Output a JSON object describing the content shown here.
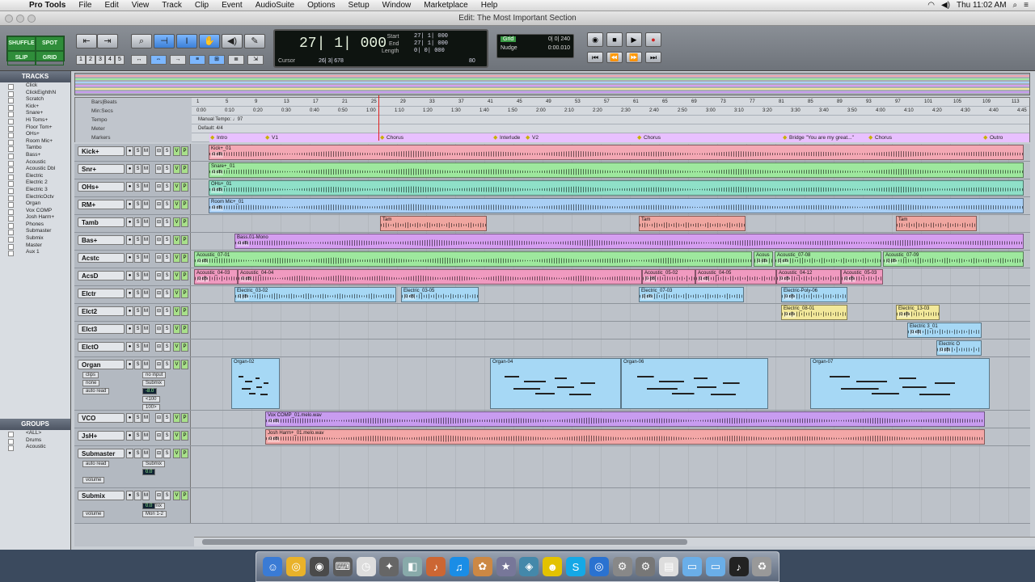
{
  "menubar": {
    "app": "Pro Tools",
    "items": [
      "File",
      "Edit",
      "View",
      "Track",
      "Clip",
      "Event",
      "AudioSuite",
      "Options",
      "Setup",
      "Window",
      "Marketplace",
      "Help"
    ],
    "clock": "Thu 11:02 AM"
  },
  "window": {
    "title": "Edit: The Most Important Section"
  },
  "toolbar": {
    "modes": [
      "SHUFFLE",
      "SPOT",
      "SLIP",
      "GRID"
    ],
    "zoom_presets": [
      "1",
      "2",
      "3",
      "4",
      "5"
    ],
    "counter": {
      "main": "27| 1| 000",
      "labels": [
        "Start",
        "End",
        "Length"
      ],
      "values": [
        "27| 1| 000",
        "27| 1| 000",
        "0| 0| 000"
      ],
      "cursor_label": "Cursor",
      "cursor_value": "26| 3| 678",
      "tempo": "80"
    },
    "grid": {
      "label": "Grid",
      "value": "0| 0| 240",
      "nudge_label": "Nudge",
      "nudge_value": "0:00.010"
    }
  },
  "tracklist": {
    "header": "TRACKS",
    "items": [
      "Click",
      "ClickEighthN",
      "Scratch",
      "Kick+",
      "Snare+",
      "Hi Toms+",
      "Floor Tom+",
      "OHs+",
      "Room Mic+",
      "Tambo",
      "Bass+",
      "Acoustic",
      "Acoustic Dbl",
      "Electric",
      "Electric 2",
      "Electric 3",
      "ElectricOctv",
      "Organ",
      "Vox COMP",
      "Josh Harm+",
      "Phones",
      "Submaster",
      "Submix",
      "Master",
      "Aux 1"
    ]
  },
  "groups": {
    "header": "GROUPS",
    "items": [
      "<ALL>",
      "Drums",
      "Acoustic"
    ]
  },
  "rulers": {
    "rows": [
      "Bars|Beats",
      "Min:Secs",
      "Tempo",
      "Meter",
      "Markers"
    ],
    "bars": [
      "1",
      "5",
      "9",
      "13",
      "17",
      "21",
      "25",
      "29",
      "33",
      "37",
      "41",
      "45",
      "49",
      "53",
      "57",
      "61",
      "65",
      "69",
      "73",
      "77",
      "81",
      "85",
      "89",
      "93",
      "97",
      "101",
      "105",
      "109",
      "113"
    ],
    "secs": [
      "0:00",
      "0:10",
      "0:20",
      "0:30",
      "0:40",
      "0:50",
      "1:00",
      "1:10",
      "1:20",
      "1:30",
      "1:40",
      "1:50",
      "2:00",
      "2:10",
      "2:20",
      "2:30",
      "2:40",
      "2:50",
      "3:00",
      "3:10",
      "3:20",
      "3:30",
      "3:40",
      "3:50",
      "4:00",
      "4:10",
      "4:20",
      "4:30",
      "4:40",
      "4:45"
    ],
    "tempo": "Manual Tempo: ♩97",
    "meter": "Default: 4/4",
    "markers": [
      "Intro",
      "V1",
      "Chorus",
      "Interlude",
      "V2",
      "Chorus",
      "Bridge \"You are my great...\"",
      "Chorus",
      "Outro"
    ]
  },
  "tracks": [
    {
      "name": "Kick+",
      "clips": [
        {
          "label": "Kick+_01",
          "db": "0 dB",
          "color": "pink"
        }
      ]
    },
    {
      "name": "Snr+",
      "clips": [
        {
          "label": "Snare+_01",
          "db": "0 dB",
          "color": "green"
        }
      ]
    },
    {
      "name": "OHs+",
      "clips": [
        {
          "label": "OHs+_01",
          "db": "0 dB",
          "color": "teal"
        }
      ]
    },
    {
      "name": "RM+",
      "clips": [
        {
          "label": "Room Mic+_01",
          "db": "0 dB",
          "color": "lblue"
        }
      ]
    },
    {
      "name": "Tamb",
      "clips": [
        {
          "label": "Tam",
          "db": "",
          "color": "rose"
        },
        {
          "label": "Tam",
          "db": "",
          "color": "rose"
        },
        {
          "label": "Tam",
          "db": "",
          "color": "rose"
        }
      ]
    },
    {
      "name": "Bas+",
      "clips": [
        {
          "label": "Bass.01-Mono",
          "db": "0 dB",
          "color": "purple"
        }
      ]
    },
    {
      "name": "Acstc",
      "clips": [
        {
          "label": "Acoustic_07-01",
          "db": "0 dB",
          "color": "green"
        },
        {
          "label": "Acous",
          "db": "0 dB",
          "color": "green"
        },
        {
          "label": "Acoustic_07-08",
          "db": "0 dB",
          "color": "green"
        },
        {
          "label": "Acoustic_07-09",
          "db": "0 dB",
          "color": "green"
        }
      ]
    },
    {
      "name": "AcsD",
      "clips": [
        {
          "label": "Acoustic_04-03",
          "db": "0 dB",
          "color": "vpink"
        },
        {
          "label": "Acoustic_04-04",
          "db": "0 dB",
          "color": "vpink"
        },
        {
          "label": "Acoustic_05-02",
          "db": "0 dB",
          "color": "vpink"
        },
        {
          "label": "Acoustic_04-05",
          "db": "0 dB",
          "color": "vpink"
        },
        {
          "label": "Acoustic_04-12",
          "db": "0 dB",
          "color": "vpink"
        },
        {
          "label": "Acoustic_05-03",
          "db": "0 dB",
          "color": "vpink"
        }
      ]
    },
    {
      "name": "Elctr",
      "clips": [
        {
          "label": "Electric_03-02",
          "db": "0 dB",
          "color": "skyb"
        },
        {
          "label": "Electric_03-05",
          "db": "0 dB",
          "color": "skyb"
        },
        {
          "label": "Electric_07-03",
          "db": "0 dB",
          "color": "skyb"
        },
        {
          "label": "Electric-Poly-06",
          "db": "0 dB",
          "color": "skyb"
        }
      ]
    },
    {
      "name": "Elct2",
      "clips": [
        {
          "label": "Electric_08-01",
          "db": "0 dB",
          "color": "yellow"
        },
        {
          "label": "Electric_13-03",
          "db": "0 dB",
          "color": "yellow"
        }
      ]
    },
    {
      "name": "Elct3",
      "clips": [
        {
          "label": "Electric 3_01",
          "db": "0 dB",
          "color": "skyb"
        }
      ]
    },
    {
      "name": "ElctO",
      "clips": [
        {
          "label": "Electric O",
          "db": "0 dB",
          "color": "skyb"
        }
      ]
    },
    {
      "name": "Organ",
      "clips": [
        {
          "label": "Organ-02",
          "db": "",
          "color": "skyb"
        },
        {
          "label": "Organ-04",
          "db": "",
          "color": "skyb"
        },
        {
          "label": "Organ-06",
          "db": "",
          "color": "skyb"
        },
        {
          "label": "Organ-07",
          "db": "",
          "color": "skyb"
        }
      ],
      "io": {
        "input": "no input",
        "output": "Submix",
        "vol": "-8.0",
        "pan_l": "<100",
        "pan_r": "100>",
        "clips": "clips",
        "none": "none",
        "auto": "auto read"
      }
    },
    {
      "name": "VCO",
      "clips": [
        {
          "label": "Vox COMP_01.melo.wav",
          "db": "0 dB",
          "color": "violet"
        }
      ]
    },
    {
      "name": "JsH+",
      "clips": [
        {
          "label": "Josh Harm+_01.melo.wav",
          "db": "0 dB",
          "color": "salmon"
        }
      ]
    },
    {
      "name": "Submaster",
      "clips": [],
      "io": {
        "output": "Submix",
        "vol": "0.0",
        "volume": "volume",
        "auto": "auto read"
      }
    },
    {
      "name": "Submix",
      "clips": [],
      "io": {
        "output": "Submix",
        "out2": "Mon 1-2",
        "vol": "0.0",
        "volume": "volume"
      }
    }
  ],
  "colors": {
    "accent": "#3c7fd6",
    "counter_bg": "#0e1410",
    "mode_green": "#2f8d3a",
    "insertion": "#e02020"
  },
  "dock": {
    "icons": [
      "finder-icon",
      "chrome-icon",
      "pro-tools-icon",
      "keyboard-icon",
      "clock-icon",
      "apps-icon",
      "preview-icon",
      "guitar-icon",
      "itunes-icon",
      "photos-icon",
      "star-icon",
      "compass-icon",
      "adium-icon",
      "skype-icon",
      "safari-icon",
      "utility-icon",
      "settings-icon",
      "notes-icon",
      "folder-icon",
      "folder-icon",
      "piano-icon",
      "trash-icon"
    ]
  }
}
